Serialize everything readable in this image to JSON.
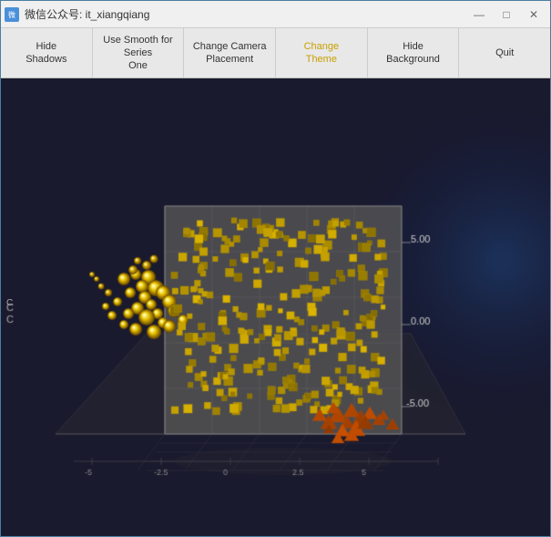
{
  "window": {
    "title": "微信公众号: it_xiangqiang",
    "icon": "W"
  },
  "titlebar": {
    "minimize": "—",
    "maximize": "□",
    "close": "✕"
  },
  "toolbar": {
    "buttons": [
      {
        "id": "hide-shadows",
        "label": "Hide\nShadows"
      },
      {
        "id": "smooth-series",
        "label": "Use Smooth for Series\nOne"
      },
      {
        "id": "camera-placement",
        "label": "Change Camera\nPlacement"
      },
      {
        "id": "change-theme",
        "label": "Change\nTheme",
        "active": true
      },
      {
        "id": "hide-background",
        "label": "Hide\nBackground"
      },
      {
        "id": "quit",
        "label": "Quit"
      }
    ]
  },
  "chart": {
    "axis_label_c": "C",
    "axis_values": [
      "5.00",
      "0.00",
      "-5.00"
    ]
  }
}
